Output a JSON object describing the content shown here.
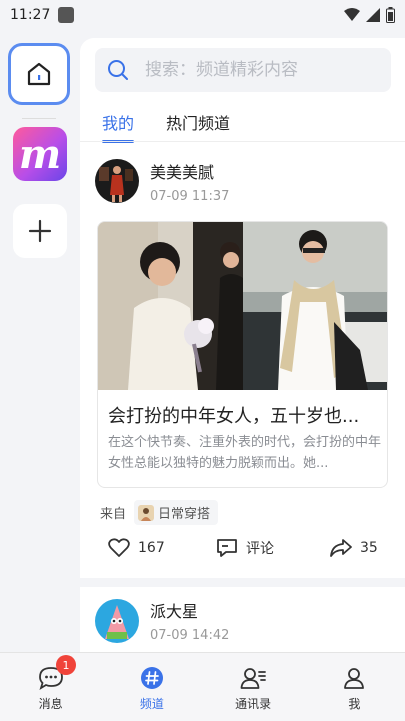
{
  "status_bar": {
    "time": "11:27"
  },
  "search": {
    "placeholder": "搜索：频道精彩内容"
  },
  "tabs": [
    {
      "label": "我的",
      "active": true
    },
    {
      "label": "热门频道",
      "active": false
    }
  ],
  "posts": [
    {
      "author": "美美美腻",
      "time": "07-09 11:37",
      "card": {
        "title": "会打扮的中年女人，五十岁也...",
        "description": "在这个快节奏、注重外表的时代，会打扮的中年女性总能以独特的魅力脱颖而出。她..."
      },
      "source_label": "来自",
      "source_channel": "日常穿搭",
      "likes": "167",
      "comment_label": "评论",
      "shares": "35"
    },
    {
      "author": "派大星",
      "time": "07-09 14:42"
    }
  ],
  "bottom_nav": [
    {
      "label": "消息",
      "badge": "1"
    },
    {
      "label": "频道",
      "active": true
    },
    {
      "label": "通讯录"
    },
    {
      "label": "我"
    }
  ],
  "colors": {
    "accent": "#3a72e8",
    "badge": "#f0433a",
    "rail_highlight": "#5b8cf0"
  }
}
